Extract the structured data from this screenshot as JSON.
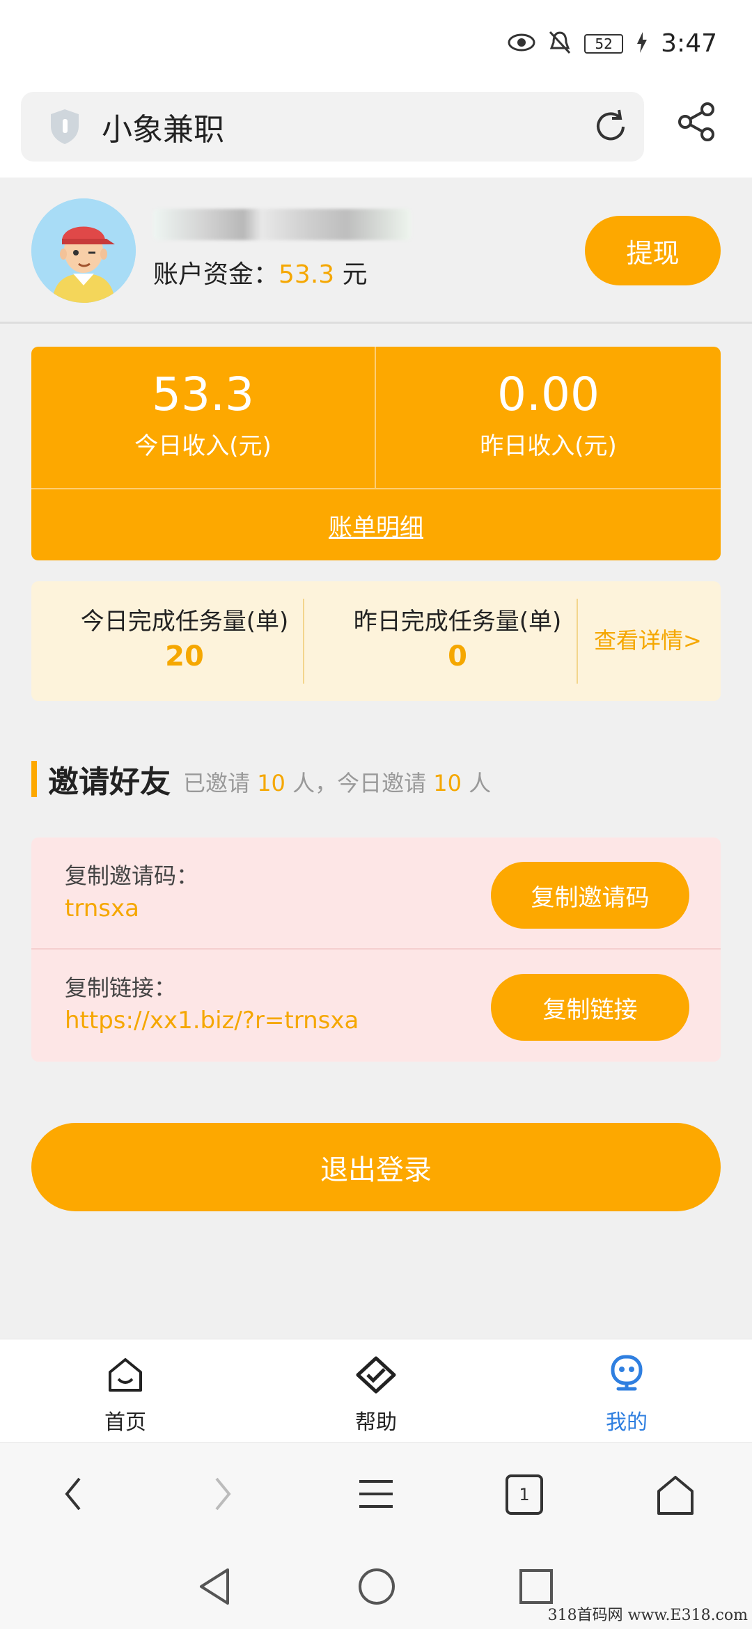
{
  "status_bar": {
    "battery": "52",
    "time": "3:47"
  },
  "browser": {
    "url_title": "小象兼职"
  },
  "profile": {
    "balance_label": "账户资金：",
    "balance_value": "53.3",
    "balance_unit": " 元",
    "withdraw_label": "提现"
  },
  "income": {
    "today_value": "53.3",
    "today_label": "今日收入(元)",
    "yesterday_value": "0.00",
    "yesterday_label": "昨日收入(元)",
    "bill_link": "账单明细"
  },
  "tasks": {
    "today_label": "今日完成任务量(单)",
    "today_value": "20",
    "yesterday_label": "昨日完成任务量(单)",
    "yesterday_value": "0",
    "detail_link": "查看详情>"
  },
  "invite": {
    "title": "邀请好友",
    "sub_prefix": "已邀请 ",
    "invited_count": "10",
    "sub_middle": " 人，今日邀请 ",
    "today_count": "10",
    "sub_suffix": " 人",
    "code_label": "复制邀请码：",
    "code_value": "trnsxa",
    "code_button": "复制邀请码",
    "link_label": "复制链接：",
    "link_value": "https://xx1.biz/?r=trnsxa",
    "link_button": "复制链接"
  },
  "logout_label": "退出登录",
  "tabs": [
    {
      "label": "首页",
      "icon": "home-icon"
    },
    {
      "label": "帮助",
      "icon": "handshake-icon"
    },
    {
      "label": "我的",
      "icon": "robot-face-icon"
    }
  ],
  "browser_nav": {
    "tab_count": "1"
  },
  "watermark": "318首码网 www.E318.com",
  "colors": {
    "accent": "#fda800",
    "accent_text": "#f5a700",
    "active_tab": "#2f7fe0",
    "invite_bg": "#fde6e6",
    "task_bg": "#fdf3db"
  }
}
